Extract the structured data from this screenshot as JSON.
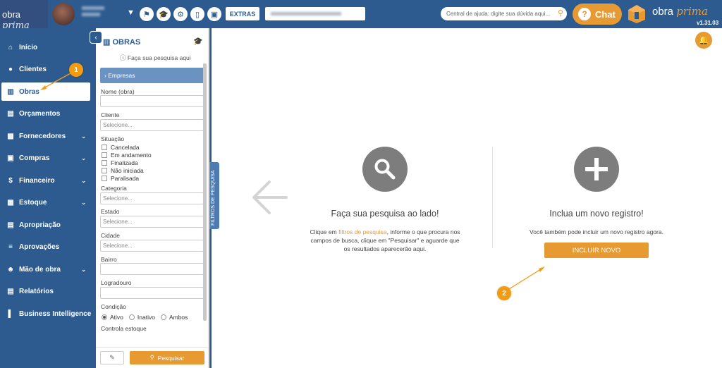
{
  "header": {
    "brand": "obra",
    "brand_italic": "prima",
    "extras_label": "EXTRAS",
    "help_search_placeholder": "Central de ajuda: digite sua dúvida aqui...",
    "chat_label": "Chat",
    "logo_text": "obra",
    "logo_italic": "prima",
    "version": "v1.31.03",
    "icons": [
      "chevron-down-icon",
      "flag-icon",
      "graduation-icon",
      "gear-icon",
      "mobile-icon",
      "monitor-icon"
    ]
  },
  "sidebar": {
    "items": [
      {
        "label": "Início",
        "icon": "home-icon"
      },
      {
        "label": "Clientes",
        "icon": "user-icon"
      },
      {
        "label": "Obras",
        "icon": "building-icon",
        "active": true
      },
      {
        "label": "Orçamentos",
        "icon": "document-icon"
      },
      {
        "label": "Fornecedores",
        "icon": "truck-icon",
        "expandable": true
      },
      {
        "label": "Compras",
        "icon": "cart-icon",
        "expandable": true
      },
      {
        "label": "Financeiro",
        "icon": "dollar-icon",
        "expandable": true
      },
      {
        "label": "Estoque",
        "icon": "box-icon",
        "expandable": true
      },
      {
        "label": "Apropriação",
        "icon": "clipboard-icon"
      },
      {
        "label": "Aprovações",
        "icon": "check-list-icon"
      },
      {
        "label": "Mão de obra",
        "icon": "workers-icon",
        "expandable": true
      },
      {
        "label": "Relatórios",
        "icon": "report-icon"
      },
      {
        "label": "Business Intelligence",
        "icon": "bar-chart-icon"
      }
    ]
  },
  "filter_panel": {
    "title": "OBRAS",
    "hint": "Faça sua pesquisa aqui",
    "empresas_label": "Empresas",
    "fields": {
      "nome_label": "Nome (obra)",
      "cliente_label": "Cliente",
      "cliente_placeholder": "Selecione...",
      "situacao_label": "Situação",
      "situacao_options": [
        "Cancelada",
        "Em andamento",
        "Finalizada",
        "Não iniciada",
        "Paralisada"
      ],
      "categoria_label": "Categoria",
      "categoria_placeholder": "Selecione...",
      "estado_label": "Estado",
      "estado_placeholder": "Selecione...",
      "cidade_label": "Cidade",
      "cidade_placeholder": "Selecione...",
      "bairro_label": "Bairro",
      "logradouro_label": "Logradouro",
      "condicao_label": "Condição",
      "condicao_options": [
        "Ativo",
        "Inativo",
        "Ambos"
      ],
      "condicao_selected": "Ativo",
      "controla_label": "Controla estoque"
    },
    "search_button": "Pesquisar",
    "side_tab": "FILTROS DE PESQUISA"
  },
  "main": {
    "search_block": {
      "title": "Faça sua pesquisa ao lado!",
      "text_before": "Clique em ",
      "text_highlight": "filtros de pesquisa",
      "text_after": ", informe o que procura nos",
      "line2": "campos de busca, clique em \"Pesquisar\" e aguarde que",
      "line3": "os resultados aparecerão aqui."
    },
    "new_block": {
      "title": "Inclua um novo registro!",
      "text": "Você também pode incluir um novo registro agora.",
      "button": "INCLUIR NOVO"
    }
  },
  "annotations": {
    "step1": "1",
    "step2": "2"
  },
  "colors": {
    "primary": "#2d5b8f",
    "accent": "#e79a31",
    "light_blue": "#6b93c2"
  }
}
